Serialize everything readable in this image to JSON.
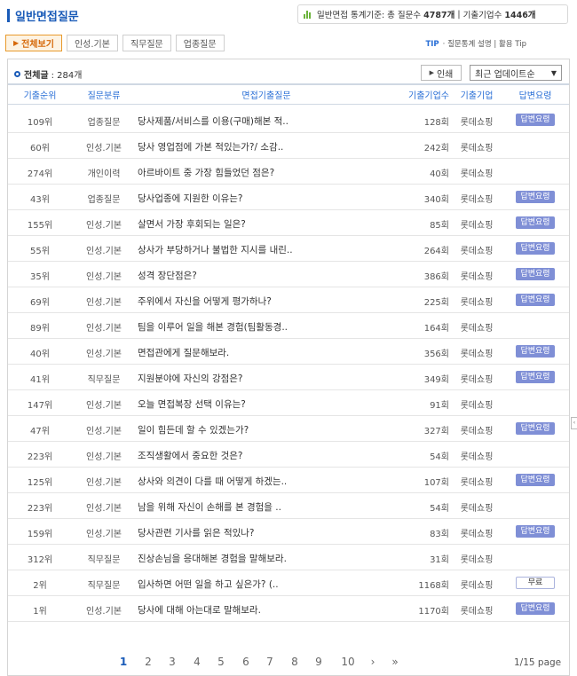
{
  "header": {
    "title": "일반면접질문",
    "stats_label": "일반면접 통계기준: 총 질문수",
    "question_count": "4787개",
    "company_label": "기출기업수",
    "company_count": "1446개",
    "separator": "|"
  },
  "tabs": [
    {
      "label": "전체보기",
      "active": true
    },
    {
      "label": "인성.기본"
    },
    {
      "label": "직무질문"
    },
    {
      "label": "업종질문"
    }
  ],
  "tip": {
    "label": "TIP",
    "text": "· 질문통계 설명 | 활용 Tip"
  },
  "toolbar": {
    "total_label": "전체글",
    "total_value": ": 284개",
    "print_label": "인쇄",
    "sort_value": "최근 업데이트순"
  },
  "columns": {
    "rank": "기출순위",
    "category": "질문분류",
    "question": "면접기출질문",
    "count": "기출기업수",
    "company": "기출기업",
    "answer": "답변요령"
  },
  "rows": [
    {
      "rank": "109위",
      "category": "업종질문",
      "question": "당사제품/서비스를 이용(구매)해본 적..",
      "count": "128회",
      "company": "롯데쇼핑",
      "answer": "답변요령"
    },
    {
      "rank": "60위",
      "category": "인성.기본",
      "question": "당사 영업점에 가본 적있는가?/ 소감..",
      "count": "242회",
      "company": "롯데쇼핑",
      "answer": ""
    },
    {
      "rank": "274위",
      "category": "개인이력",
      "question": "아르바이트 중 가장 힘들었던 점은?",
      "count": "40회",
      "company": "롯데쇼핑",
      "answer": ""
    },
    {
      "rank": "43위",
      "category": "업종질문",
      "question": "당사업종에 지원한 이유는?",
      "count": "340회",
      "company": "롯데쇼핑",
      "answer": "답변요령"
    },
    {
      "rank": "155위",
      "category": "인성.기본",
      "question": "살면서 가장 후회되는 일은?",
      "count": "85회",
      "company": "롯데쇼핑",
      "answer": "답변요령"
    },
    {
      "rank": "55위",
      "category": "인성.기본",
      "question": "상사가 부당하거나 불법한 지시를 내린..",
      "count": "264회",
      "company": "롯데쇼핑",
      "answer": "답변요령"
    },
    {
      "rank": "35위",
      "category": "인성.기본",
      "question": "성격 장단점은?",
      "count": "386회",
      "company": "롯데쇼핑",
      "answer": "답변요령"
    },
    {
      "rank": "69위",
      "category": "인성.기본",
      "question": "주위에서 자신을 어떻게 평가하나?",
      "count": "225회",
      "company": "롯데쇼핑",
      "answer": "답변요령"
    },
    {
      "rank": "89위",
      "category": "인성.기본",
      "question": "팀을 이루어 일을 해본 경험(팀활동경..",
      "count": "164회",
      "company": "롯데쇼핑",
      "answer": ""
    },
    {
      "rank": "40위",
      "category": "인성.기본",
      "question": "면접관에게 질문해보라.",
      "count": "356회",
      "company": "롯데쇼핑",
      "answer": "답변요령"
    },
    {
      "rank": "41위",
      "category": "직무질문",
      "question": "지원분야에 자신의 강점은?",
      "count": "349회",
      "company": "롯데쇼핑",
      "answer": "답변요령"
    },
    {
      "rank": "147위",
      "category": "인성.기본",
      "question": "오늘 면접복장 선택 이유는?",
      "count": "91회",
      "company": "롯데쇼핑",
      "answer": ""
    },
    {
      "rank": "47위",
      "category": "인성.기본",
      "question": "일이 힘든데 할 수 있겠는가?",
      "count": "327회",
      "company": "롯데쇼핑",
      "answer": "답변요령"
    },
    {
      "rank": "223위",
      "category": "인성.기본",
      "question": "조직생활에서 중요한 것은?",
      "count": "54회",
      "company": "롯데쇼핑",
      "answer": ""
    },
    {
      "rank": "125위",
      "category": "인성.기본",
      "question": "상사와 의견이 다를 때 어떻게 하겠는..",
      "count": "107회",
      "company": "롯데쇼핑",
      "answer": "답변요령"
    },
    {
      "rank": "223위",
      "category": "인성.기본",
      "question": "남을 위해 자신이 손해를 본 경험을 ..",
      "count": "54회",
      "company": "롯데쇼핑",
      "answer": ""
    },
    {
      "rank": "159위",
      "category": "인성.기본",
      "question": "당사관련 기사를 읽은 적있나?",
      "count": "83회",
      "company": "롯데쇼핑",
      "answer": "답변요령"
    },
    {
      "rank": "312위",
      "category": "직무질문",
      "question": "진상손님을 응대해본 경험을 말해보라.",
      "count": "31회",
      "company": "롯데쇼핑",
      "answer": ""
    },
    {
      "rank": "2위",
      "category": "직무질문",
      "question": "입사하면 어떤 일을 하고 싶은가? (..",
      "count": "1168회",
      "company": "롯데쇼핑",
      "answer": "무료"
    },
    {
      "rank": "1위",
      "category": "인성.기본",
      "question": "당사에 대해 아는대로 말해보라.",
      "count": "1170회",
      "company": "롯데쇼핑",
      "answer": "답변요령"
    }
  ],
  "pagination": {
    "pages": [
      "1",
      "2",
      "3",
      "4",
      "5",
      "6",
      "7",
      "8",
      "9",
      "10"
    ],
    "current": "1",
    "next": "›",
    "last": "»",
    "info": "1/15 page"
  },
  "colors": {
    "accent": "#1a5bb8",
    "tab_active": "#d6690a",
    "answer_badge": "#7f8fd6",
    "header_text": "#2a6fd6"
  }
}
